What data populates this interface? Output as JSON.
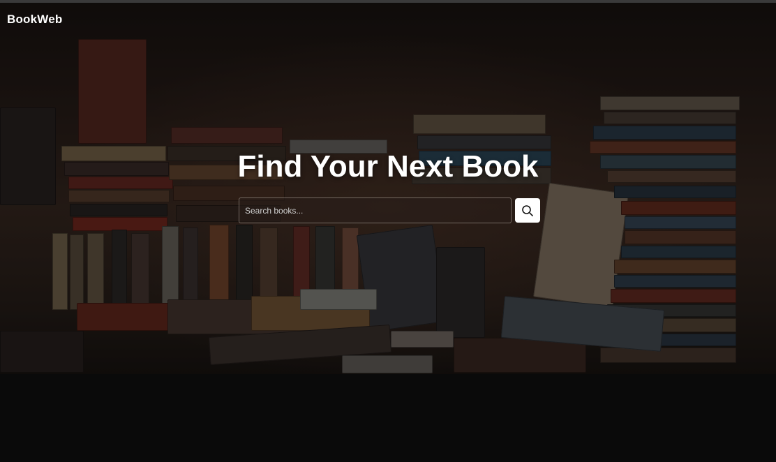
{
  "header": {
    "brand": "BookWeb"
  },
  "hero": {
    "title": "Find Your Next Book",
    "background_image": "bookstore-books-stacks"
  },
  "search": {
    "placeholder": "Search books...",
    "value": "",
    "button_icon": "search-icon"
  },
  "colors": {
    "page_background": "#0a0a0a",
    "title_text": "#ffffff",
    "button_background": "#ffffff"
  }
}
